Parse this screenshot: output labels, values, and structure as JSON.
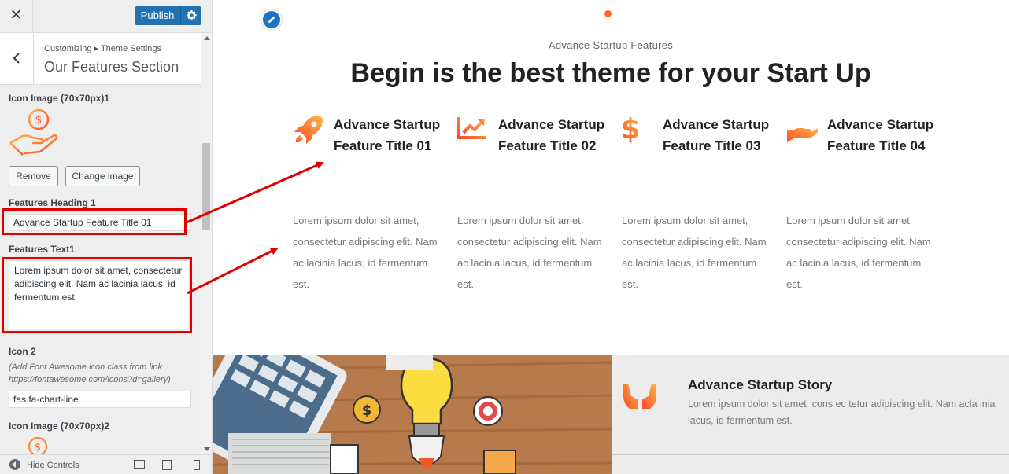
{
  "customizer": {
    "close_glyph": "✕",
    "publish_label": "Publish",
    "breadcrumb": "Customizing ▸ Theme Settings",
    "panel_title": "Our Features Section",
    "icon_image_1_label": "Icon Image (70x70px)1",
    "remove_label": "Remove",
    "change_image_label": "Change image",
    "features_heading_1_label": "Features Heading 1",
    "features_heading_1_value": "Advance Startup Feature Title 01",
    "features_text_1_label": "Features Text1",
    "features_text_1_value": "Lorem ipsum dolor sit amet, consectetur adipiscing elit. Nam ac lacinia lacus, id fermentum est.",
    "icon_2_label": "Icon 2",
    "icon_2_desc": "(Add Font Awesome icon class from link https://fontawesome.com/icons?d=gallery)",
    "icon_2_value": "fas fa-chart-line",
    "icon_image_2_label": "Icon Image (70x70px)2",
    "hide_controls_label": "Hide Controls",
    "accent_color": "#2271b1",
    "highlight_color": "#e00000"
  },
  "preview": {
    "section_kicker": "Advance Startup Features",
    "section_title": "Begin is the best theme for your Start Up",
    "accent_gradient": [
      "#ff4b2b",
      "#ffb347"
    ],
    "features": [
      {
        "icon": "rocket-icon",
        "title": "Advance Startup Feature Title 01",
        "text": "Lorem ipsum dolor sit amet, consectetur adipiscing elit. Nam ac lacinia lacus, id fermentum est."
      },
      {
        "icon": "chart-line-icon",
        "title": "Advance Startup Feature Title 02",
        "text": "Lorem ipsum dolor sit amet, consectetur adipiscing elit. Nam ac lacinia lacus, id fermentum est."
      },
      {
        "icon": "dollar-icon",
        "title": "Advance Startup Feature Title 03",
        "text": "Lorem ipsum dolor sit amet, consectetur adipiscing elit. Nam ac lacinia lacus, id fermentum est."
      },
      {
        "icon": "hand-icon",
        "title": "Advance Startup Feature Title 04",
        "text": "Lorem ipsum dolor sit amet, consectetur adipiscing elit. Nam ac lacinia lacus, id fermentum est."
      }
    ],
    "story": {
      "title": "Advance Startup Story",
      "text": "Lorem ipsum dolor sit amet, cons ec tetur adipiscing elit. Nam acla inia lacus, id fermentum est."
    }
  }
}
